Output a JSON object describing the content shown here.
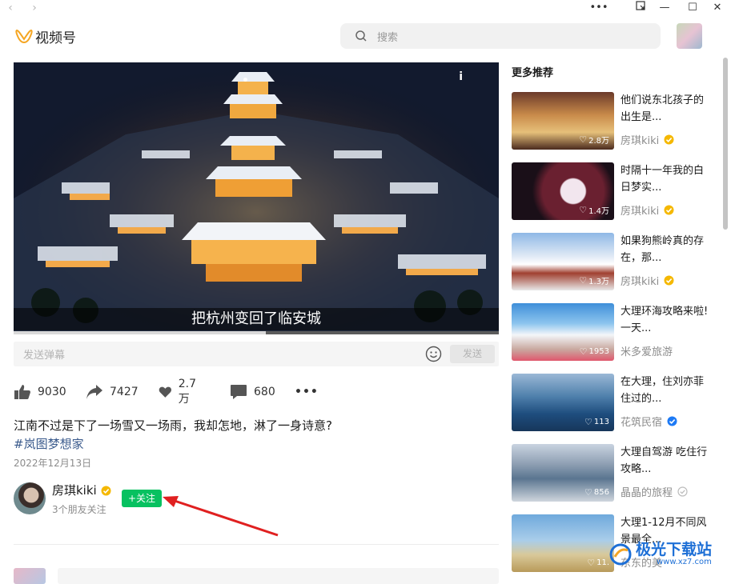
{
  "window": {
    "back_icon": "chevron-left-icon",
    "forward_icon": "chevron-right-icon",
    "more_label": "•••",
    "restore_icon": "pip-icon",
    "minimize_label": "—",
    "maximize_label": "☐",
    "close_label": "✕"
  },
  "header": {
    "app_name": "视频号",
    "search_placeholder": "搜索"
  },
  "video": {
    "subtitle": "把杭州变回了临安城",
    "info_label": "i",
    "progress_fraction": 0.52
  },
  "danmaku": {
    "placeholder": "发送弹幕",
    "send_label": "发送"
  },
  "actions": {
    "likes": "9030",
    "shares": "7427",
    "hearts": "2.7万",
    "comments": "680",
    "more": "•••"
  },
  "post": {
    "description": "江南不过是下了一场雪又一场雨，我却怎地，淋了一身诗意?",
    "hashtag": "#岚图梦想家",
    "date": "2022年12月13日"
  },
  "author": {
    "name": "房琪kiki",
    "friends_following": "3个朋友关注",
    "follow_label": "+关注"
  },
  "sidebar": {
    "title": "更多推荐",
    "items": [
      {
        "title": "他们说东北孩子的出生是...",
        "likes": "2.8万",
        "author": "房琪kiki",
        "badge": "gold"
      },
      {
        "title": "时隔十一年我的白日梦实...",
        "likes": "1.4万",
        "author": "房琪kiki",
        "badge": "gold"
      },
      {
        "title": "如果狗熊岭真的存在，那...",
        "likes": "1.3万",
        "author": "房琪kiki",
        "badge": "gold"
      },
      {
        "title": "大理环海攻略来啦! 一天...",
        "likes": "1953",
        "author": "米多爱旅游",
        "badge": "none"
      },
      {
        "title": "在大理，住刘亦菲住过的...",
        "likes": "113",
        "author": "花筑民宿",
        "badge": "blue"
      },
      {
        "title": "大理自驾游 吃住行攻略...",
        "likes": "856",
        "author": "晶晶的旅程",
        "badge": "gray"
      },
      {
        "title": "大理1-12月不同风景最全...",
        "likes": "11.",
        "author": "东东的美",
        "badge": "none"
      }
    ]
  },
  "watermark": {
    "line1": "极光下载站",
    "line2": "www.xz7.com"
  },
  "colors": {
    "accent_green": "#07c160",
    "gold_badge": "#f5b800",
    "blue_badge": "#1d7af5",
    "annotation_arrow": "#e02020"
  }
}
